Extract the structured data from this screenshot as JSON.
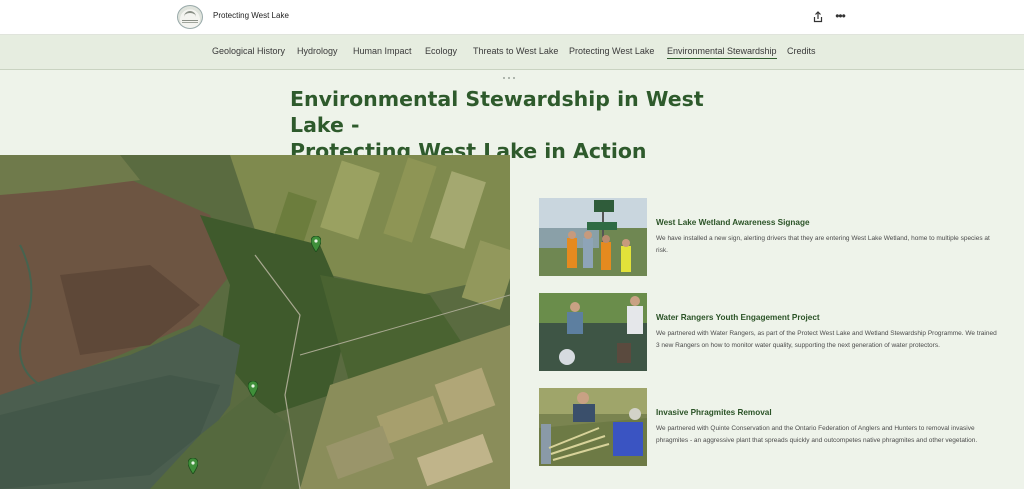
{
  "header": {
    "site_title": "Protecting West Lake",
    "logo_icon": "west-lake-logo",
    "share_icon": "share-icon",
    "more_icon": "more-icon"
  },
  "nav": {
    "items": [
      {
        "label": "Geological History"
      },
      {
        "label": "Hydrology"
      },
      {
        "label": "Human Impact"
      },
      {
        "label": "Ecology"
      },
      {
        "label": "Threats to West Lake"
      },
      {
        "label": "Protecting West Lake"
      },
      {
        "label": "Environmental Stewardship",
        "active": true
      },
      {
        "label": "Credits"
      }
    ]
  },
  "main": {
    "title_line1": "Environmental Stewardship in West Lake -",
    "title_line2": "Protecting West Lake in Action"
  },
  "map": {
    "pins": 3,
    "pin_color": "#3f8f3a"
  },
  "cards": [
    {
      "title": "West Lake Wetland Awareness Signage",
      "text": "We have installed a new sign, alerting drivers that they are entering West Lake Wetland, home to multiple species at risk."
    },
    {
      "title": "Water Rangers Youth Engagement Project",
      "text": "We partnered with Water Rangers, as part of the Protect West Lake and Wetland Stewardship Programme. We trained 3 new Rangers on how to monitor water quality, supporting the next generation of water protectors."
    },
    {
      "title": "Invasive Phragmites Removal",
      "text": "We partnered with Quinte Conservation and the Ontario Federation of Anglers and Hunters to removal invasive phragmites - an aggressive plant that spreads quickly and outcompetes native phragmites and other vegetation."
    }
  ],
  "colors": {
    "accent": "#2e5a2c",
    "nav_bg": "#e6ede0",
    "page_bg": "#eef3ea"
  }
}
